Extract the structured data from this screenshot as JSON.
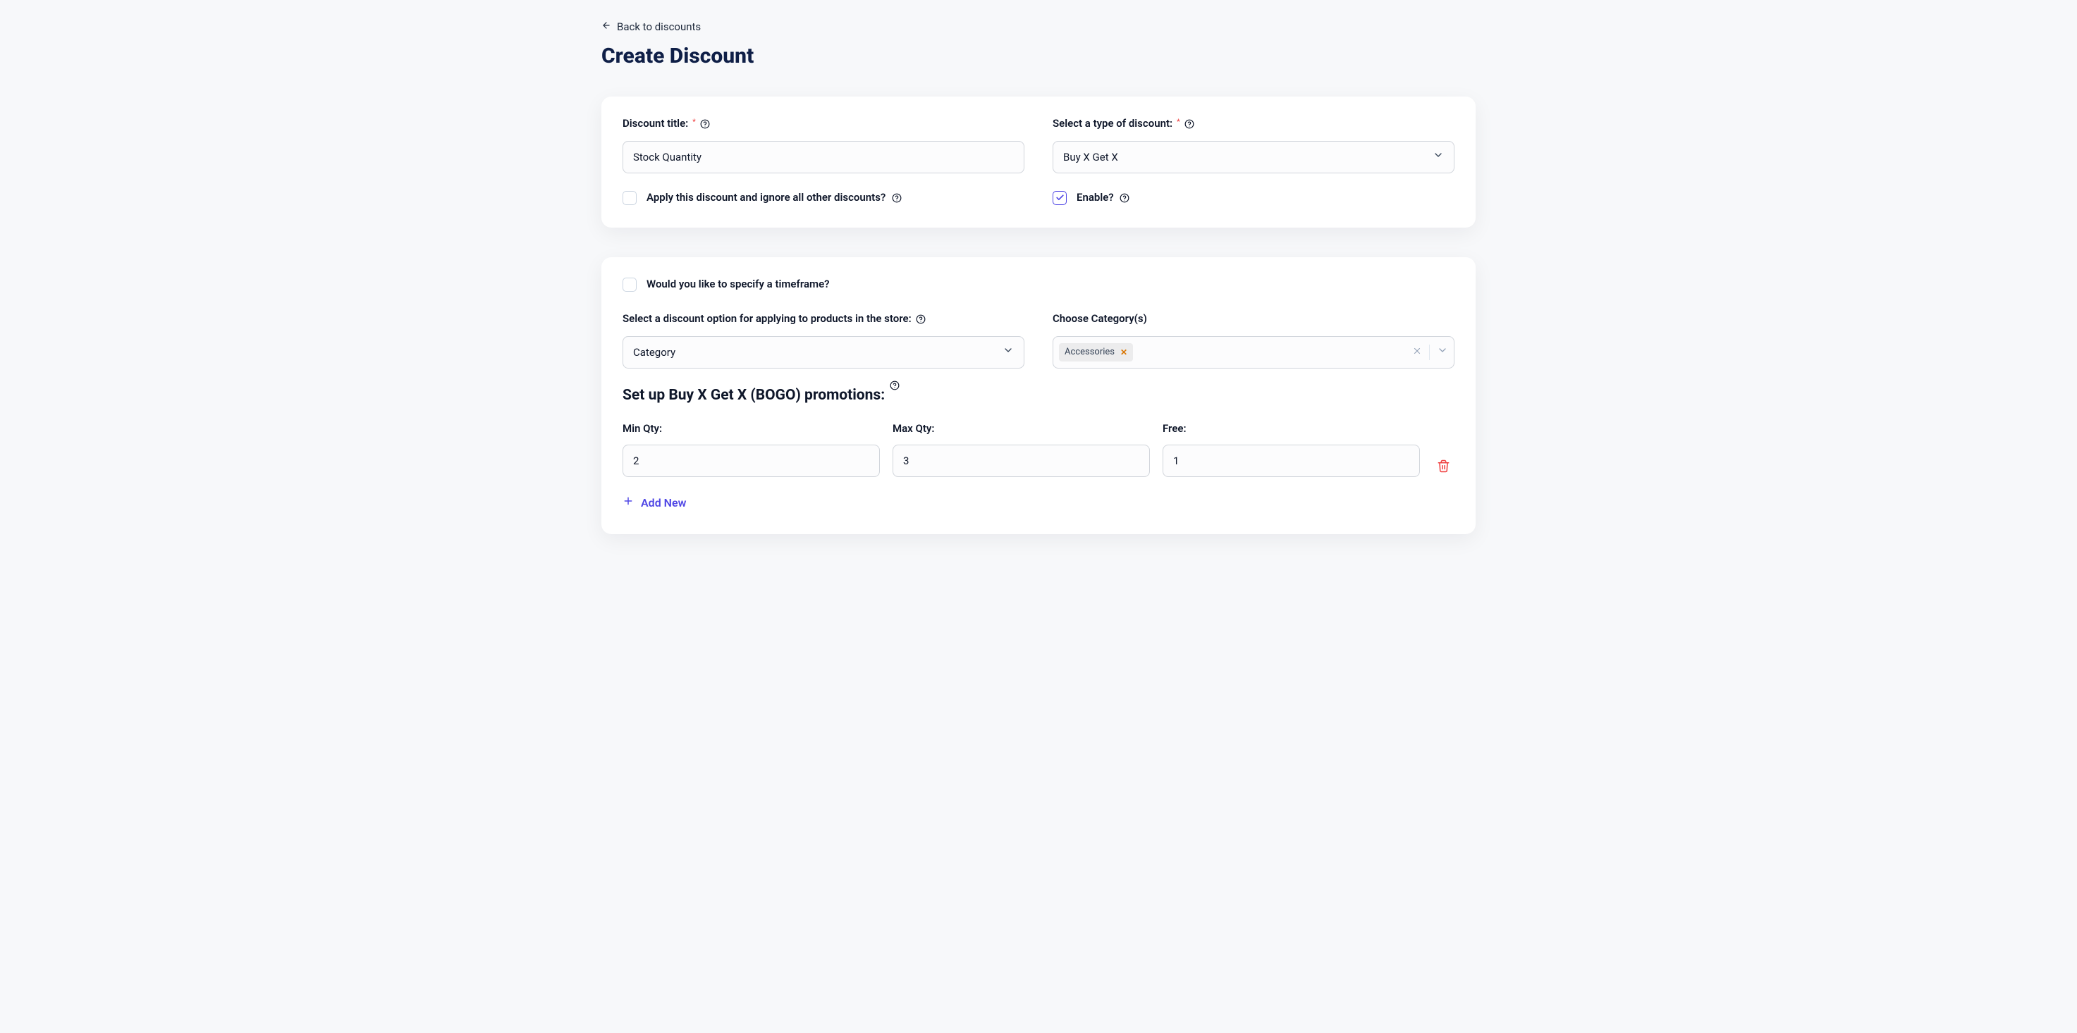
{
  "back": {
    "label": "Back to discounts"
  },
  "page_title": "Create Discount",
  "card1": {
    "title_label": "Discount title:",
    "title_value": "Stock Quantity",
    "type_label": "Select a type of discount:",
    "type_value": "Buy X Get X",
    "ignore_label": "Apply this discount and ignore all other discounts?",
    "enable_label": "Enable?"
  },
  "card2": {
    "timeframe_label": "Would you like to specify a timeframe?",
    "option_label": "Select a discount option for applying to products in the store:",
    "option_value": "Category",
    "category_label": "Choose Category(s)",
    "category_tags": [
      "Accessories"
    ],
    "section_heading": "Set up Buy X Get X (BOGO) promotions:",
    "qty": {
      "min_label": "Min Qty:",
      "min_value": "2",
      "max_label": "Max Qty:",
      "max_value": "3",
      "free_label": "Free:",
      "free_value": "1"
    },
    "add_new_label": "Add New"
  }
}
